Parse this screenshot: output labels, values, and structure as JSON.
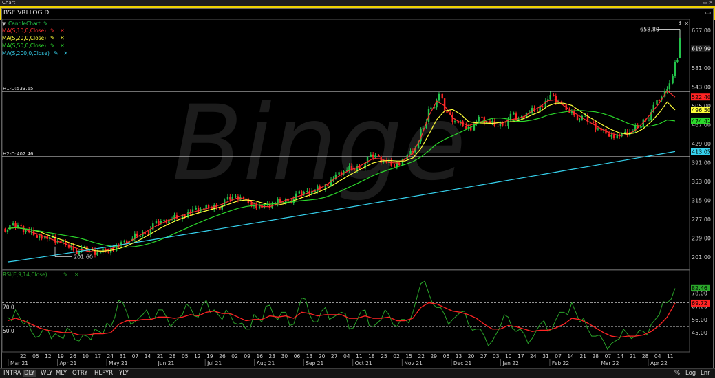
{
  "window": {
    "title": "Chart"
  },
  "chart_header": {
    "symbol": "BSE VRLLOG D"
  },
  "legend": {
    "candle": {
      "label": "CandleChart",
      "color": "#23c44b"
    },
    "items": [
      {
        "label": "MA(S,10,0,Close)",
        "color": "#ff3030"
      },
      {
        "label": "MA(S,20,0,Close)",
        "color": "#ffff3a"
      },
      {
        "label": "MA(S,50,0,Close)",
        "color": "#2bd82b"
      },
      {
        "label": "MA(S,200,0,Close)",
        "color": "#36d2ee"
      }
    ],
    "rsi": {
      "label": "RSI(E,9,14,Close)",
      "color": "#2aa52a"
    }
  },
  "colors": {
    "up": "#23c44b",
    "down": "#ff2424",
    "grid": "#3a3a3a"
  },
  "chart_data": [
    {
      "type": "candlestick",
      "ylim": [
        176,
        676
      ],
      "y_ticks": [
        "657.00",
        "619.90",
        "581.00",
        "543.00",
        "505.00",
        "467.00",
        "429.00",
        "391.00",
        "353.00",
        "315.00",
        "277.00",
        "239.00",
        "201.00"
      ],
      "x_tick_labels": [
        "22",
        "05",
        "12",
        "19",
        "26",
        "10",
        "17",
        "24",
        "31",
        "07",
        "14",
        "21",
        "28",
        "05",
        "12",
        "19",
        "26",
        "02",
        "09",
        "16",
        "23",
        "30",
        "06",
        "13",
        "20",
        "27",
        "04",
        "11",
        "18",
        "25",
        "02",
        "15",
        "22",
        "29",
        "06",
        "13",
        "20",
        "27",
        "03",
        "10",
        "17",
        "24",
        "31",
        "07",
        "14",
        "21",
        "28",
        "07",
        "14",
        "21",
        "28",
        "04",
        "11"
      ],
      "month_labels": [
        "Mar 21",
        "Apr 21",
        "May 21",
        "Jun 21",
        "Jul 21",
        "Aug 21",
        "Sep 21",
        "Oct 21",
        "Nov 21",
        "Dec 21",
        "Jan 22",
        "Feb 22",
        "Mar 22",
        "Apr 22"
      ],
      "horizontal_lines": [
        {
          "label": "H1-D:533.65",
          "value": 533.65
        },
        {
          "label": "H2-D:402.46",
          "value": 402.46
        }
      ],
      "annotations": [
        {
          "label": "658.80",
          "value": 658.8
        },
        {
          "label": "201.60",
          "value": 201.6
        }
      ],
      "last_values": [
        {
          "label": "619.90",
          "value": 619.9,
          "color": "#1c1c1c"
        },
        {
          "label": "522.40",
          "value": 522.4,
          "color": "#ff2424"
        },
        {
          "label": "496.50",
          "value": 496.5,
          "color": "#ffff3a"
        },
        {
          "label": "474.41",
          "value": 474.41,
          "color": "#2bd82b"
        },
        {
          "label": "413.05",
          "value": 413.05,
          "color": "#36d2ee"
        }
      ],
      "close_series": [
        258,
        262,
        254,
        248,
        244,
        236,
        232,
        226,
        219,
        214,
        212,
        210,
        215,
        220,
        226,
        232,
        244,
        252,
        262,
        270,
        276,
        282,
        287,
        292,
        296,
        300,
        304,
        310,
        318,
        322,
        312,
        305,
        300,
        304,
        312,
        318,
        322,
        328,
        333,
        340,
        350,
        362,
        372,
        378,
        384,
        396,
        402,
        394,
        388,
        392,
        402,
        418,
        462,
        506,
        522,
        488,
        474,
        468,
        462,
        478,
        472,
        466,
        470,
        482,
        476,
        490,
        498,
        508,
        522,
        512,
        498,
        490,
        478,
        470,
        460,
        452,
        446,
        444,
        450,
        462,
        480,
        500,
        520,
        550,
        600
      ],
      "ma_series_meta": [
        {
          "name": "MA10",
          "end": 522.4
        },
        {
          "name": "MA20",
          "end": 496.5
        },
        {
          "name": "MA50",
          "end": 474.41
        },
        {
          "name": "MA200",
          "end": 413.05,
          "start": 191
        }
      ]
    },
    {
      "type": "line",
      "name": "RSI",
      "ylim": [
        30,
        95
      ],
      "y_ticks": [
        "78.00",
        "67.00",
        "56.00",
        "45.00"
      ],
      "levels": [
        {
          "label": "70.0",
          "value": 70
        },
        {
          "label": "50.0",
          "value": 50
        }
      ],
      "last_values": [
        {
          "label": "82.46",
          "value": 82.46,
          "color": "#2aa52a"
        },
        {
          "label": "69.72",
          "value": 69.72,
          "color": "#ff2424"
        }
      ],
      "rsi_series": [
        58,
        64,
        52,
        46,
        42,
        48,
        44,
        40,
        46,
        38,
        42,
        48,
        44,
        50,
        72,
        62,
        54,
        60,
        56,
        64,
        58,
        54,
        60,
        66,
        58,
        72,
        64,
        56,
        60,
        52,
        48,
        60,
        54,
        68,
        56,
        62,
        52,
        74,
        60,
        54,
        66,
        58,
        62,
        48,
        56,
        64,
        50,
        56,
        60,
        50,
        56,
        62,
        86,
        78,
        66,
        60,
        56,
        62,
        52,
        48,
        42,
        38,
        50,
        58,
        46,
        44,
        40,
        52,
        46,
        56,
        62,
        70,
        54,
        48,
        42,
        38,
        36,
        40,
        44,
        42,
        46,
        52,
        60,
        70,
        82
      ],
      "rsi_signal_series": [
        55,
        57,
        55,
        52,
        49,
        47,
        46,
        45,
        45,
        43,
        43,
        44,
        44,
        45,
        52,
        55,
        55,
        56,
        56,
        58,
        58,
        57,
        58,
        60,
        59,
        62,
        63,
        61,
        61,
        58,
        55,
        56,
        56,
        59,
        58,
        59,
        57,
        62,
        61,
        59,
        60,
        60,
        60,
        57,
        57,
        59,
        57,
        57,
        58,
        55,
        55,
        57,
        66,
        70,
        69,
        66,
        63,
        62,
        60,
        57,
        52,
        48,
        48,
        51,
        50,
        48,
        46,
        47,
        47,
        49,
        52,
        57,
        56,
        53,
        49,
        45,
        42,
        41,
        42,
        42,
        43,
        46,
        51,
        58,
        69.72
      ]
    }
  ],
  "bottom_bar": {
    "timeframes": [
      "INTRA",
      "DLY",
      "WLY",
      "MLY",
      "QTRY",
      "HLFYR",
      "YLY"
    ],
    "active": "DLY",
    "right_buttons": [
      "%",
      "Log",
      "Lnr"
    ]
  }
}
